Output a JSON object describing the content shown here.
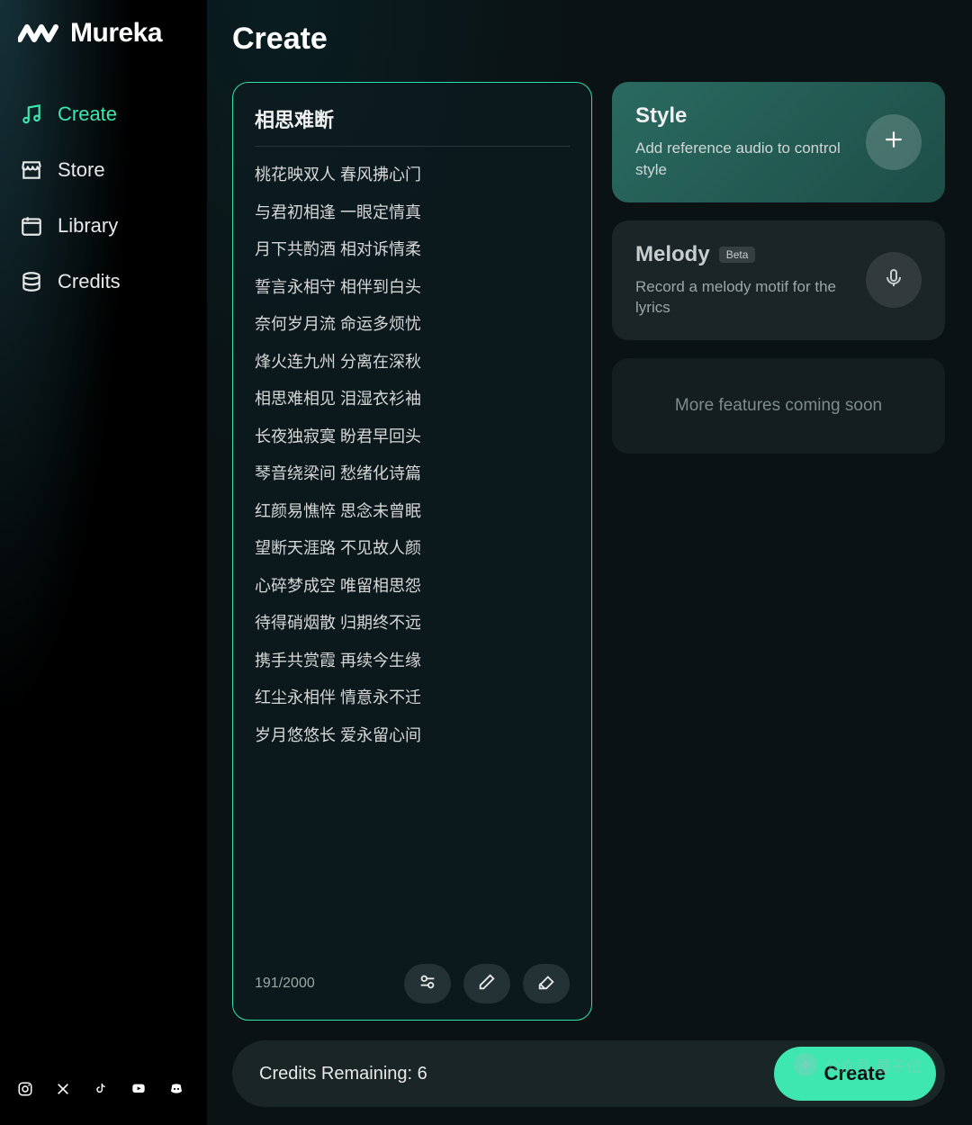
{
  "app": {
    "name": "Mureka"
  },
  "nav": {
    "create": "Create",
    "store": "Store",
    "library": "Library",
    "credits": "Credits"
  },
  "page": {
    "title": "Create"
  },
  "editor": {
    "title": "相思难断",
    "lines": [
      "桃花映双人 春风拂心门",
      "与君初相逢 一眼定情真",
      "月下共酌酒 相对诉情柔",
      "誓言永相守 相伴到白头",
      "奈何岁月流 命运多烦忧",
      "烽火连九州 分离在深秋",
      "相思难相见 泪湿衣衫袖",
      "长夜独寂寞 盼君早回头",
      "琴音绕梁间 愁绪化诗篇",
      "红颜易憔悴 思念未曾眠",
      "望断天涯路 不见故人颜",
      "心碎梦成空 唯留相思怨",
      "待得硝烟散 归期终不远",
      "携手共赏霞 再续今生缘",
      "红尘永相伴 情意永不迁",
      "岁月悠悠长 爱永留心间"
    ],
    "char_count": "191/2000"
  },
  "style_card": {
    "title": "Style",
    "desc": "Add reference audio to control style"
  },
  "melody_card": {
    "title": "Melody",
    "badge": "Beta",
    "desc": "Record a melody motif for the lyrics"
  },
  "coming_card": {
    "text": "More features coming soon"
  },
  "bottom": {
    "credits_label": "Credits Remaining: 6",
    "create_label": "Create"
  },
  "watermark": {
    "text": "公众号·量子位"
  }
}
